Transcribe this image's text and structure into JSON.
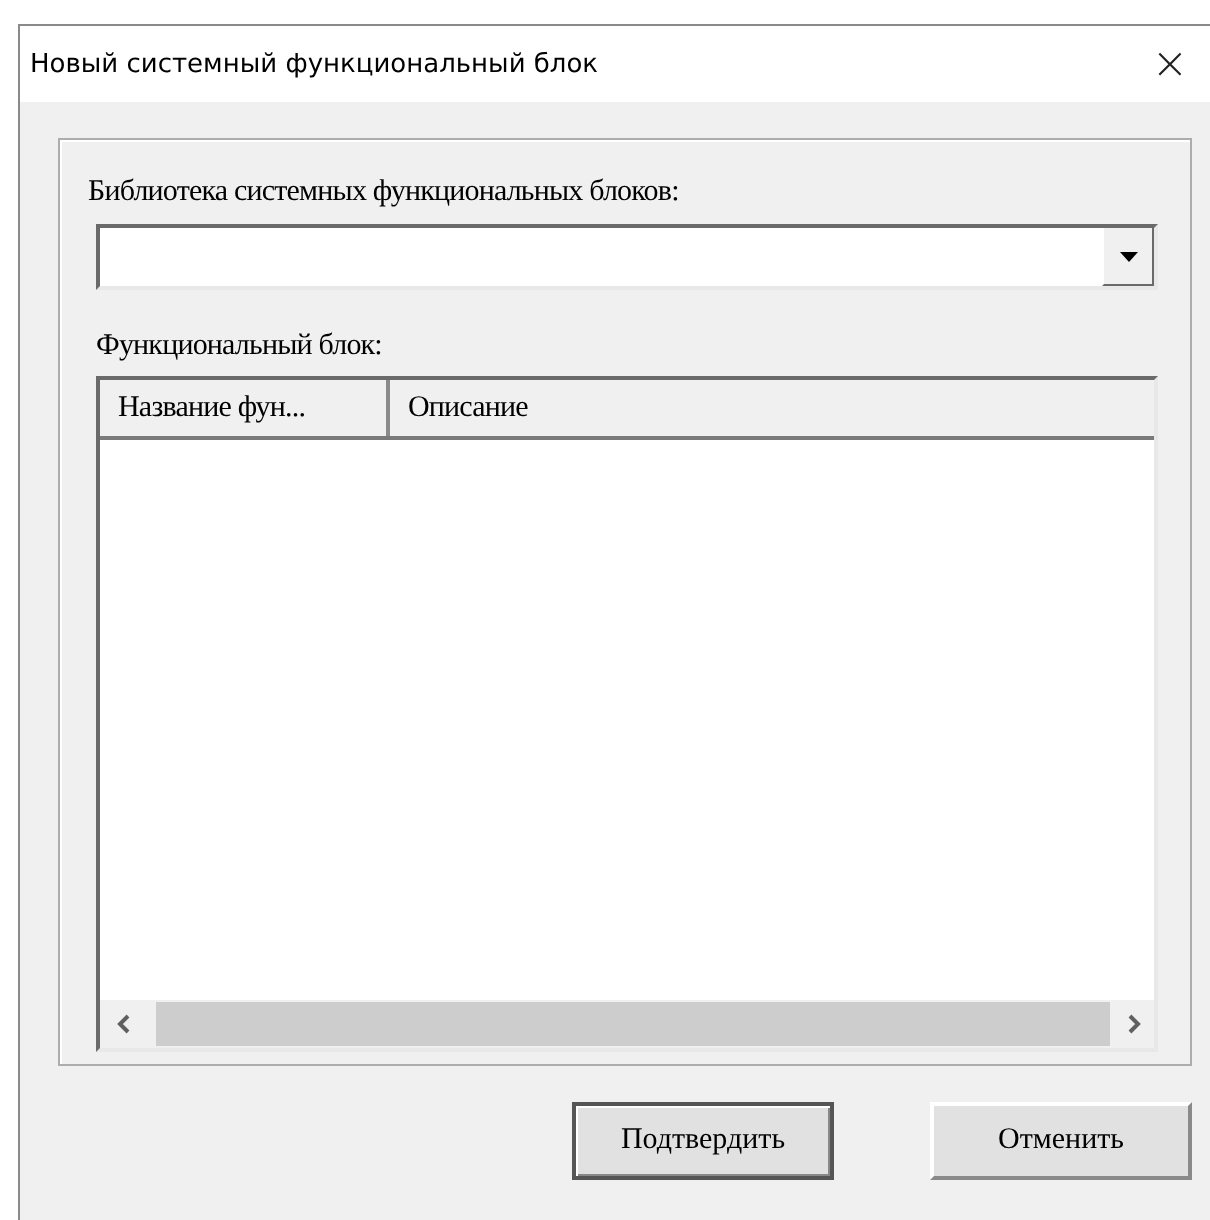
{
  "window": {
    "title": "Новый системный функциональный блок",
    "close": "×"
  },
  "library": {
    "label": "Библиотека системных функциональных блоков:"
  },
  "block": {
    "label": "Функциональный блок:",
    "columns": [
      "Название фун...",
      "Описание"
    ]
  },
  "buttons": [
    {
      "label": "Подтвердить",
      "default": true
    },
    {
      "label": "Отменить",
      "default": false
    }
  ]
}
